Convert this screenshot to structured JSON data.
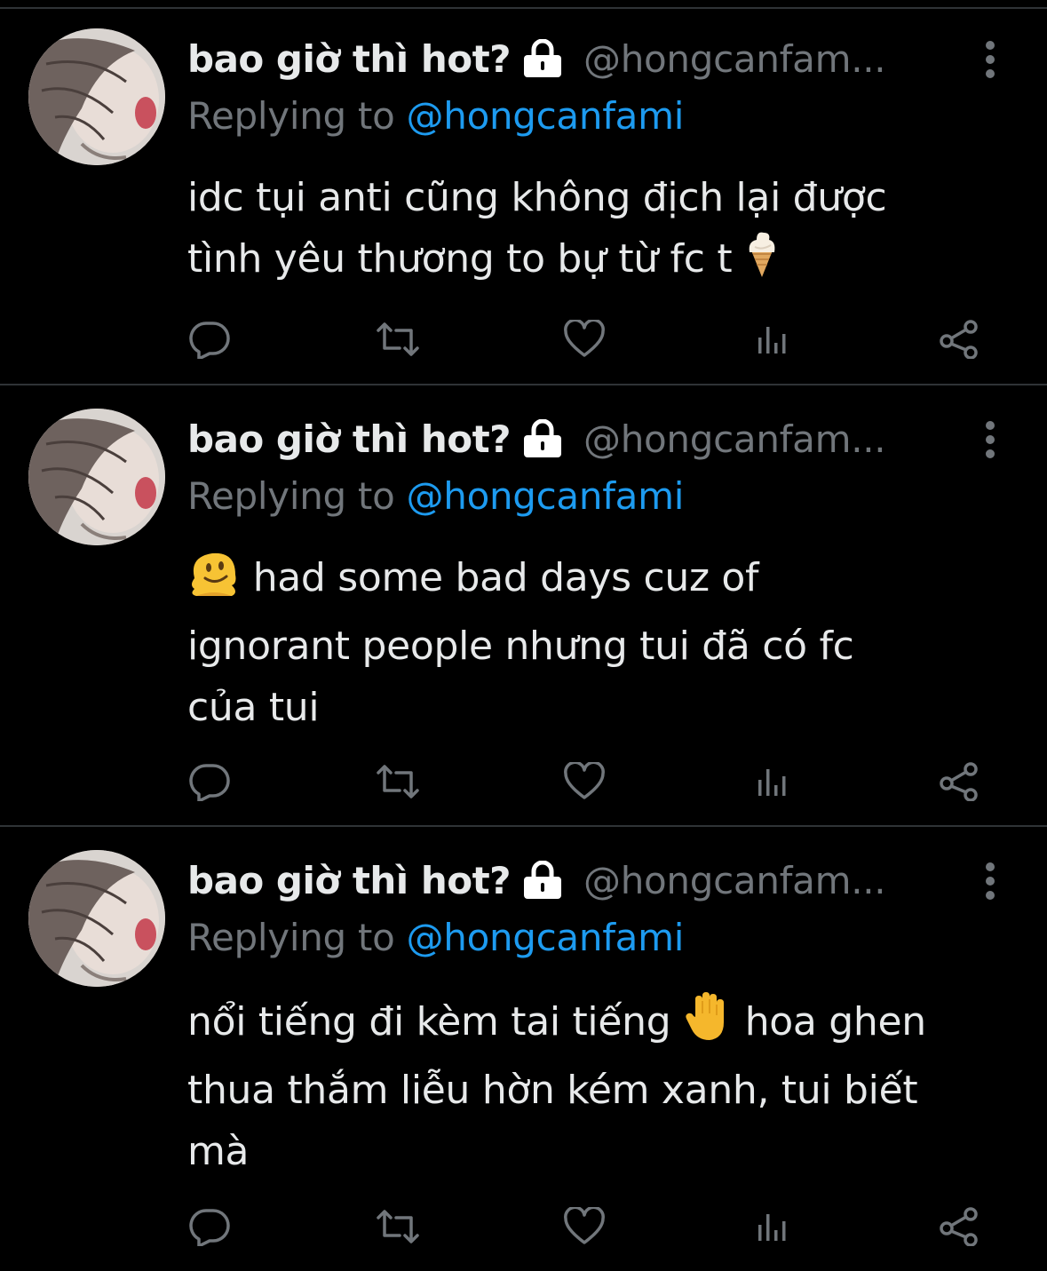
{
  "colors": {
    "background": "#000000",
    "text": "#e7e9ea",
    "secondary": "#71767b",
    "link": "#1d9bf0",
    "divider": "#2f3336"
  },
  "icons": {
    "lock": "lock-icon",
    "more": "more-vertical-icon",
    "reply": "reply-icon",
    "retweet": "retweet-icon",
    "like": "heart-icon",
    "views": "views-icon",
    "share": "share-icon"
  },
  "tweets": [
    {
      "display_name": "bao giờ thì hot?",
      "handle": "@hongcanfam...",
      "replying_prefix": "Replying to ",
      "replying_handle": "@hongcanfami",
      "text_lines": [
        "idc tụi anti cũng không địch lại được",
        "tình yêu thương to bự từ fc t"
      ],
      "emoji": "ice-cream-emoji"
    },
    {
      "display_name": "bao giờ thì hot?",
      "handle": "@hongcanfam...",
      "replying_prefix": "Replying to ",
      "replying_handle": "@hongcanfami",
      "text_lines": [
        "had some bad days cuz of",
        "ignorant people nhưng tui đã có fc",
        "của tui"
      ],
      "emoji": "melting-face-emoji"
    },
    {
      "display_name": "bao giờ thì hot?",
      "handle": "@hongcanfam...",
      "replying_prefix": "Replying to ",
      "replying_handle": "@hongcanfami",
      "text_lines": [
        "nổi tiếng đi kèm tai tiếng",
        "hoa ghen",
        "thua thắm liễu hờn kém xanh, tui biết",
        "mà"
      ],
      "emoji": "raised-hand-emoji"
    }
  ]
}
